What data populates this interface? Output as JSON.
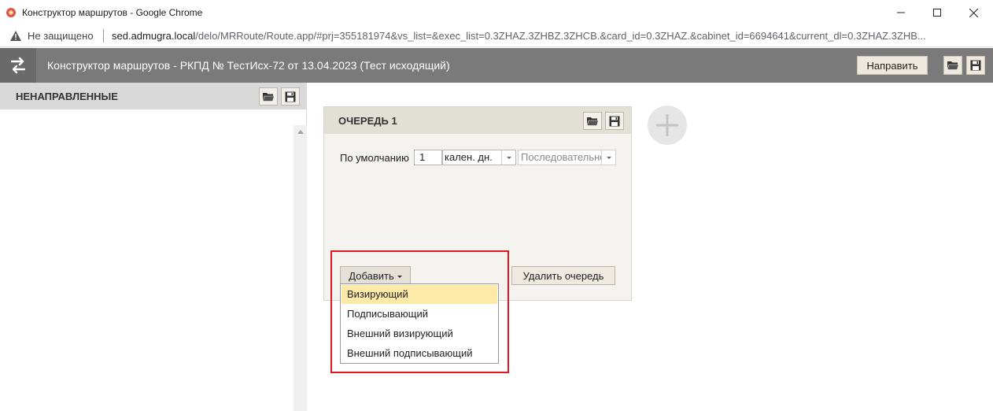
{
  "window": {
    "title": "Конструктор маршрутов - Google Chrome"
  },
  "addressbar": {
    "security": "Не защищено",
    "url_host": "sed.admugra.local",
    "url_path": "/delo/MRRoute/Route.app/#prj=355181974&vs_list=&exec_list=0.3ZHAZ.3ZHBZ.3ZHCB.&card_id=0.3ZHAZ.&cabinet_id=6694641&current_dl=0.3ZHAZ.3ZHB..."
  },
  "header": {
    "title": "Конструктор маршрутов - РКПД № ТестИсх-72 от 13.04.2023 (Тест исходящий)",
    "send_label": "Направить"
  },
  "left_panel": {
    "title": "НЕНАПРАВЛЕННЫЕ"
  },
  "queue": {
    "title": "ОЧЕРЕДЬ 1",
    "default_label": "По умолчанию",
    "days_value": "1",
    "unit_value": "кален. дн.",
    "order_value": "Последовательно",
    "add_label": "Добавить",
    "delete_label": "Удалить очередь"
  },
  "add_menu": {
    "items": [
      "Визирующий",
      "Подписывающий",
      "Внешний визирующий",
      "Внешний подписывающий"
    ],
    "highlighted_index": 0
  },
  "colors": {
    "header_bg": "#7a7a7a",
    "highlight": "#fde9a8",
    "annotation_border": "#e0171f"
  }
}
